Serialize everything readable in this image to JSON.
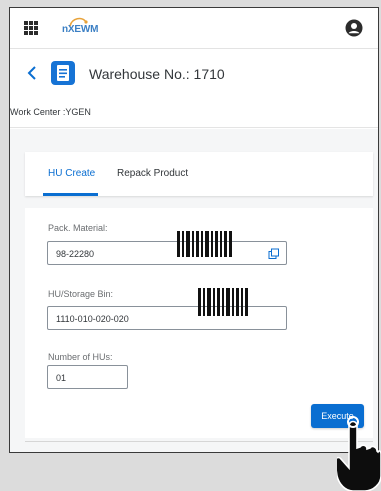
{
  "shell": {
    "logo_text": "nXEWM",
    "menu_icon": "grid-menu-icon",
    "user_icon": "user-avatar-icon"
  },
  "header": {
    "back_icon": "chevron-left-icon",
    "app_icon": "document-icon",
    "title": "Warehouse No.: 1710"
  },
  "work_center": {
    "text": "Work Center :YGEN"
  },
  "tabs": [
    {
      "label": "HU Create",
      "selected": true
    },
    {
      "label": "Repack Product",
      "selected": false
    }
  ],
  "form": {
    "pack_material": {
      "label": "Pack. Material:",
      "value": "98-22280",
      "icon": "value-help-icon"
    },
    "hu_storage_bin": {
      "label": "HU/Storage Bin:",
      "value": "1110-010-020-020"
    },
    "number_of_hus": {
      "label": "Number of HUs:",
      "value": "01"
    }
  },
  "actions": {
    "execute_label": "Execute"
  },
  "overlays": {
    "barcode_icon": "barcode-icon",
    "pointer_icon": "hand-pointer-icon"
  },
  "colors": {
    "accent": "#0a6ed1",
    "text": "#32363a",
    "label": "#6a6d70",
    "background": "#f5f6f7"
  }
}
